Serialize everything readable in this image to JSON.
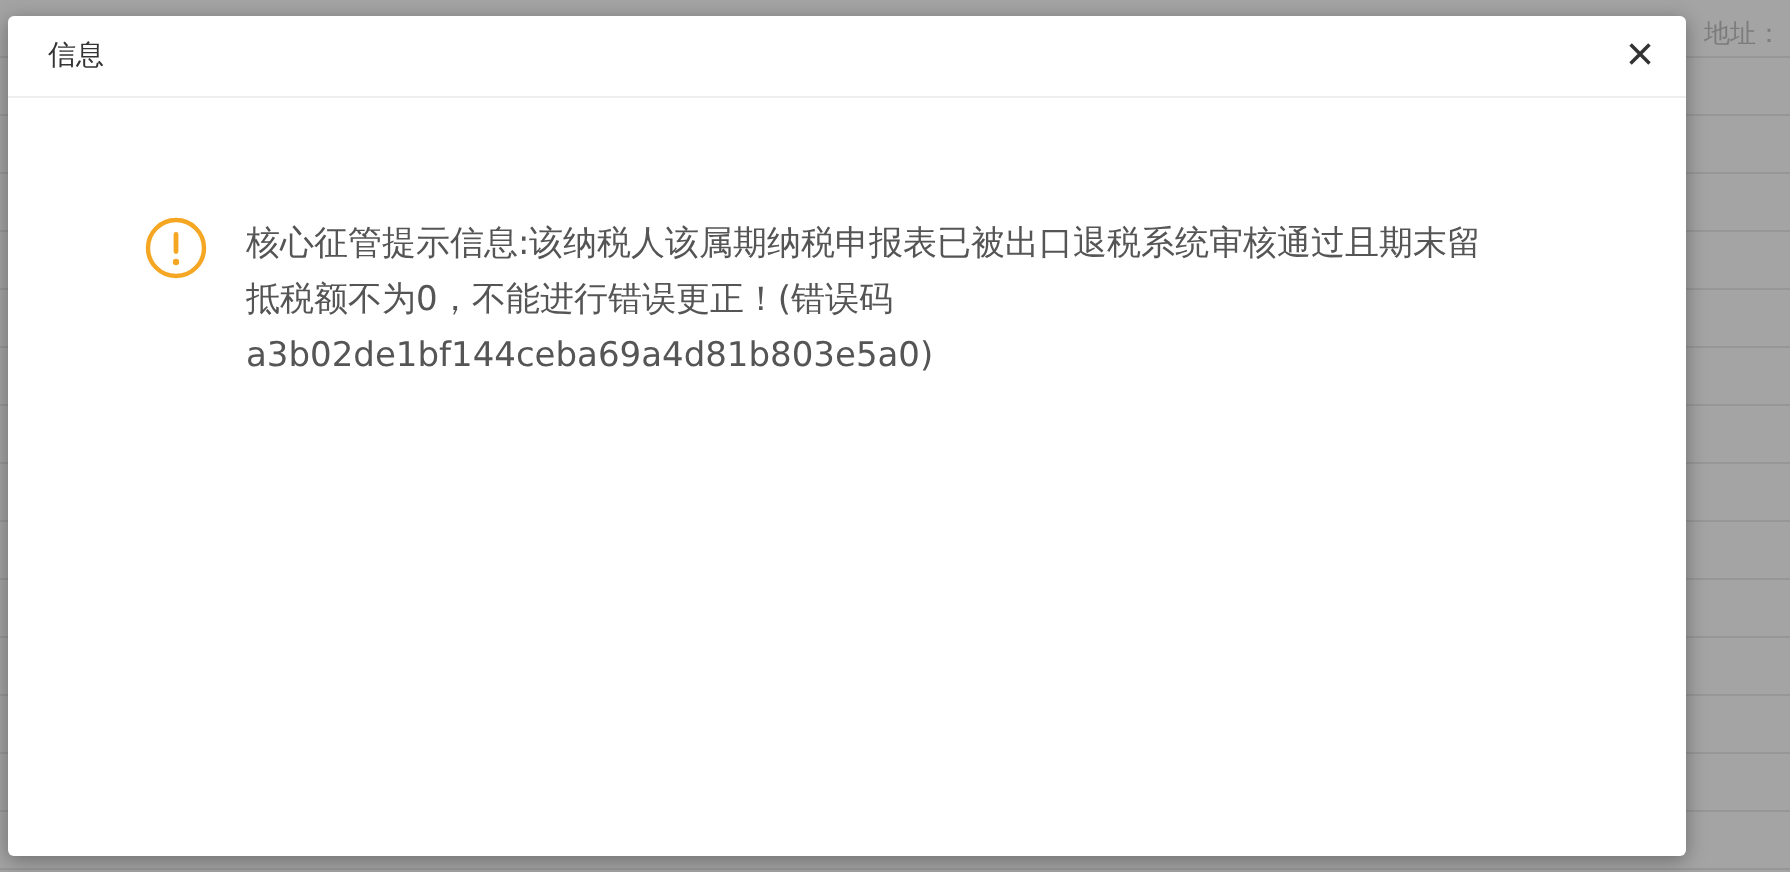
{
  "background": {
    "label": "地址："
  },
  "dialog": {
    "title": "信息",
    "close": "×",
    "message": "核心征管提示信息:该纳税人该属期纳税申报表已被出口退税系统审核通过且期末留抵税额不为0，不能进行错误更正！(错误码a3b02de1bf144ceba69a4d81b803e5a0)"
  }
}
